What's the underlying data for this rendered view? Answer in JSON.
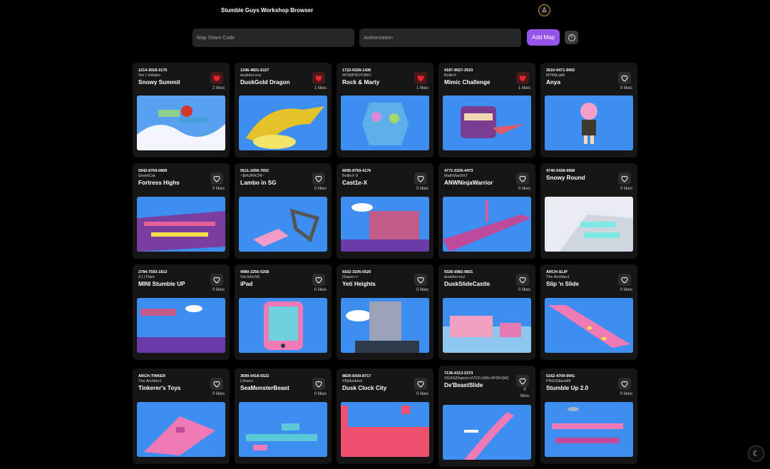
{
  "app": {
    "title": "Stumble Guys Workshop Browser",
    "avatar_icon": "user-avatar-icon"
  },
  "form": {
    "code_placeholder": "Map Share Code",
    "auth_placeholder": "Authorization",
    "add_label": "Add Map",
    "help_icon": "?"
  },
  "theme_toggle_icon": "☾",
  "colors": {
    "accent": "#9454e8",
    "liked": "#e5252f",
    "card": "#161616"
  },
  "maps": [
    {
      "code": "1214-3018-3175",
      "author": "Sm | Vollabo",
      "name": "Snowy Summit",
      "likes": "2 likes",
      "liked": true
    },
    {
      "code": "1345-4601-6157",
      "author": "duskboi-xnz",
      "name": "DuskGold Dragon",
      "likes": "1 likes",
      "liked": true
    },
    {
      "code": "1722-6328-1436",
      "author": "MTM|PROT3RO",
      "name": "Rock & Marty",
      "likes": "1 likes",
      "liked": true
    },
    {
      "code": "4187-9027-2533",
      "author": "BollieX",
      "name": "Mimic Challenge",
      "likes": "1 likes",
      "liked": true
    },
    {
      "code": "3510-0471-9002",
      "author": "MTM|Latt0",
      "name": "Anya",
      "likes": "0 likes",
      "liked": false
    },
    {
      "code": "5942-8769-0809",
      "author": "GreekCat",
      "name": "Fortress Highs",
      "likes": "0 likes",
      "liked": false
    },
    {
      "code": "5611-1658-7652",
      "author": "~$HURIK3N~",
      "name": "Lambo in SG",
      "likes": "0 likes",
      "liked": false
    },
    {
      "code": "6695-8750-4176",
      "author": "BollieX-9",
      "name": "Cast1e-X",
      "likes": "0 likes",
      "liked": false
    },
    {
      "code": "4771-5326-4473",
      "author": "MathMan9X7",
      "name": "ANWNinjaWarrior",
      "likes": "0 likes",
      "liked": false
    },
    {
      "code": "4740-5438-9958",
      "author": "",
      "name": "Snowy Round",
      "likes": "0 likes",
      "liked": false
    },
    {
      "code": "2784-7593-1813",
      "author": "ZJ | Flare",
      "name": "MINI Stumble UP",
      "likes": "0 likes",
      "liked": false
    },
    {
      "code": "4980-2256-0258",
      "author": "SmJohnSK",
      "name": "iPad",
      "likes": "0 likes",
      "liked": false
    },
    {
      "code": "9162-3106-0520",
      "author": "|Super>>",
      "name": "Yeti Heights",
      "likes": "0 likes",
      "liked": false
    },
    {
      "code": "9326-6982-9831",
      "author": "duskboi-xnz",
      "name": "DuskSlideCastle",
      "likes": "0 likes",
      "liked": false
    },
    {
      "code": "ARCH-SLIP",
      "author": "The Architect",
      "name": "Slip 'n Slide",
      "likes": "0 likes",
      "liked": false
    },
    {
      "code": "ARCH-TINKER",
      "author": "The Architect",
      "name": "Tinkerer's Toys",
      "likes": "0 likes",
      "liked": false
    },
    {
      "code": "3690-0418-5522",
      "author": "L4neex",
      "name": "SeaMonsterBeast",
      "likes": "0 likes",
      "liked": false
    },
    {
      "code": "8829-6430-8717",
      "author": "XN|duskboi",
      "name": "Dusk Clock City",
      "likes": "0 likes",
      "liked": false
    },
    {
      "code": "7136-6313-5373",
      "author": "SGAS|Depu/x<#7CF>{W}<#F00>[W]",
      "name": "De'BeastSlide",
      "likes": "0 likes",
      "liked": false
    },
    {
      "code": "5162-4709-9941",
      "author": "PNG/Gitara88",
      "name": "Stumble Up 2.0",
      "likes": "0 likes",
      "liked": false
    }
  ]
}
